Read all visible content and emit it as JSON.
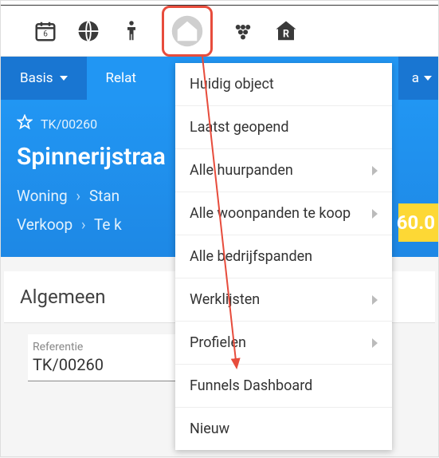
{
  "tabs": {
    "basis": "Basis",
    "relat": "Relat",
    "right_frag": "a"
  },
  "record": {
    "reference": "TK/00260",
    "title": "Spinnerijstraa",
    "crumb1a": "Woning",
    "crumb1b": "Stan",
    "crumb2a": "Verkoop",
    "crumb2b": "Te k",
    "price_frag": "60.0"
  },
  "section": {
    "title": "Algemeen",
    "field_label": "Referentie",
    "field_value": "TK/00260"
  },
  "menu": {
    "items": [
      {
        "label": "Huidig object",
        "submenu": false
      },
      {
        "label": "Laatst geopend",
        "submenu": false
      },
      {
        "label": "Alle huurpanden",
        "submenu": true
      },
      {
        "label": "Alle woonpanden te koop",
        "submenu": true
      },
      {
        "label": "Alle bedrijfspanden",
        "submenu": false
      },
      {
        "label": "Werklijsten",
        "submenu": true
      },
      {
        "label": "Profielen",
        "submenu": true
      },
      {
        "label": "Funnels Dashboard",
        "submenu": false
      },
      {
        "label": "Nieuw",
        "submenu": false
      }
    ]
  }
}
